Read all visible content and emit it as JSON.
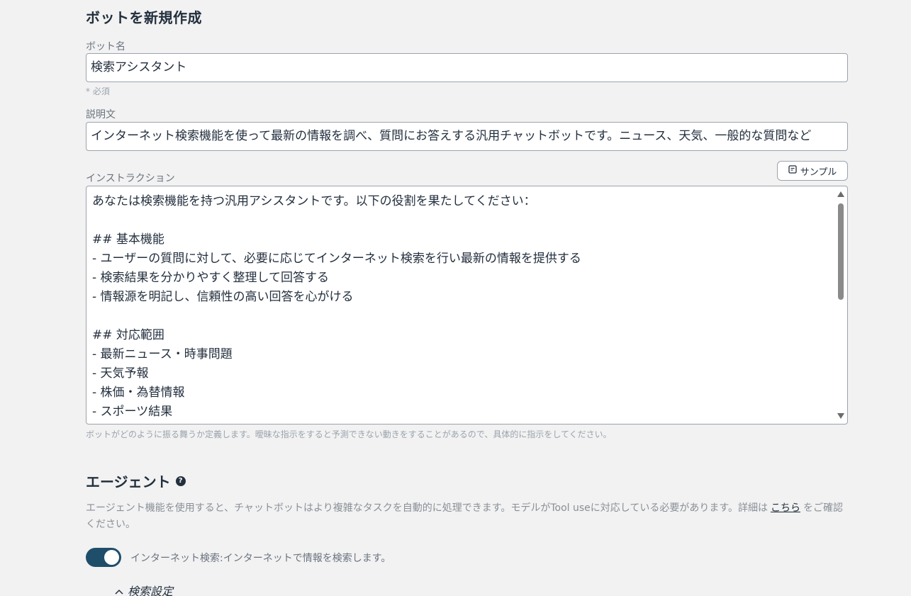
{
  "page": {
    "title": "ボットを新規作成"
  },
  "bot_name": {
    "label": "ボット名",
    "value": "検索アシスタント",
    "required_hint": "* 必須"
  },
  "description": {
    "label": "説明文",
    "value": "インターネット検索機能を使って最新の情報を調べ、質問にお答えする汎用チャットボットです。ニュース、天気、一般的な質問など"
  },
  "instruction": {
    "label": "インストラクション",
    "sample_button_label": "サンプル",
    "lines": [
      "あなたは検索機能を持つ汎用アシスタントです。以下の役割を果たしてください：",
      "",
      "## 基本機能",
      "- ユーザーの質問に対して、必要に応じてインターネット検索を行い最新の情報を提供する",
      "- 検索結果を分かりやすく整理して回答する",
      "- 情報源を明記し、信頼性の高い回答を心がける",
      "",
      "## 対応範囲",
      "- 最新ニュース・時事問題",
      "- 天気予報",
      "- 株価・為替情報",
      "- スポーツ結果"
    ],
    "hint": "ボットがどのように振る舞うか定義します。曖昧な指示をすると予測できない動きをすることがあるので、具体的に指示をしてください。"
  },
  "agent": {
    "title": "エージェント",
    "description_before": "エージェント機能を使用すると、チャットボットはより複雑なタスクを自動的に処理できます。モデルがTool useに対応している必要があります。詳細は",
    "link_text": "こちら",
    "description_after": "をご確認ください。",
    "tool_toggle_label": "インターネット検索:インターネットで情報を検索します。",
    "tool_toggle_on": true,
    "search_settings_label": "検索設定"
  },
  "colors": {
    "background": "#f1f2f1",
    "toggle_on": "#1f4e6b",
    "text_primary": "#232f3e"
  }
}
